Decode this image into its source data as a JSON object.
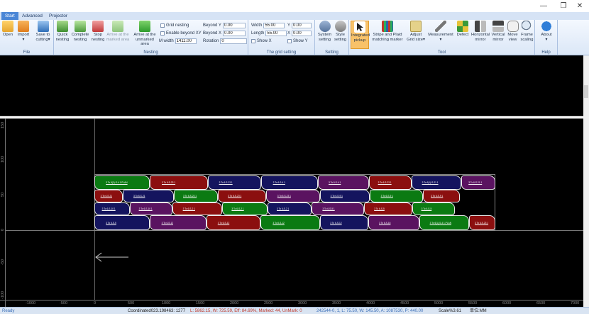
{
  "window": {
    "min_glyph": "—",
    "max_glyph": "❐",
    "close_glyph": "✕"
  },
  "tabs": [
    {
      "label": "Start",
      "active": true
    },
    {
      "label": "Advanced",
      "active": false
    },
    {
      "label": "Projector",
      "active": false
    }
  ],
  "ribbon": {
    "file": {
      "group_label": "File",
      "open": "Open",
      "import": "Import",
      "import_arrow": "▾",
      "save_to_cutting": "Save to cutting▾"
    },
    "nesting": {
      "group_label": "Nesting",
      "quick": "Quick nesting",
      "complete": "Complete nesting",
      "stop": "Stop nesting",
      "arrive_marked": "Arrive at the marked area",
      "arrive_unmarked": "Arrive at the unmarked area",
      "grid_nesting": "Grid nesting",
      "enable_beyond_xy": "Enable beyond XY",
      "m_width_label": "M width",
      "m_width_value": "1411.00",
      "beyond_y_label": "Beyond Y",
      "beyond_y_value": "0.00",
      "beyond_x_label": "Beyond X",
      "beyond_x_value": "0.00",
      "rotation_label": "Rotation",
      "rotation_value": "0"
    },
    "grid_setting": {
      "group_label": "The grid setting",
      "width_label": "Width",
      "width_value": "55.00",
      "length_label": "Length",
      "length_value": "55.00",
      "y_label": "Y",
      "y_value": "0.00",
      "x_label": "X",
      "x_value": "0.00",
      "show_x": "Show X",
      "show_y": "Show Y"
    },
    "setting": {
      "group_label": "Setting",
      "system": "System setting",
      "style": "Style setting"
    },
    "tool": {
      "group_label": "Tool",
      "integrated_pickup": "Integrated pickup",
      "stripe_plaid": "Stripe and Plaid matching marker",
      "adjust_grid": "Adjust Grid size▾",
      "measurement": "Measurement",
      "measurement_arrow": "▾",
      "defect": "Defect",
      "hmirror": "Horizontal mirror",
      "vmirror": "Vertical mirror",
      "move_view": "Move view",
      "frame_scaling": "Frame scaling"
    },
    "help": {
      "group_label": "Help",
      "about": "About",
      "about_arrow": "▾"
    }
  },
  "rulers": {
    "left": [
      "150",
      "100",
      "50",
      "0",
      "-50",
      "-100"
    ],
    "bottom": [
      "-1000",
      "-500",
      "0",
      "500",
      "1000",
      "1500",
      "2000",
      "2500",
      "3000",
      "3500",
      "4000",
      "4500",
      "5000",
      "5500",
      "6000",
      "6500",
      "7000"
    ]
  },
  "pieces": [
    {
      "c": "#0b7a12",
      "label": "3 To 6(1)-S-4 1.PLAN"
    },
    {
      "c": "#8b0f0f",
      "label": "3 To 6-S-23 1"
    },
    {
      "c": "#14145e",
      "label": "3 To 6-S-23 1"
    },
    {
      "c": "#14145e",
      "label": "3 To 6-S-4 1"
    },
    {
      "c": "#5a1360",
      "label": "3 To 6-S-4 1"
    },
    {
      "c": "#8b0f0f",
      "label": "3 To 6-S-23 1"
    },
    {
      "c": "#14145e",
      "label": "3 To 6(1)-S-21 1"
    },
    {
      "c": "#5a1360",
      "label": "3 To 6-S-21 1"
    },
    {
      "c": "#8b0f0f",
      "label": "3 To 6-S-21"
    },
    {
      "c": "#14145e",
      "label": "3 To 6-S-21"
    },
    {
      "c": "#0b7a12",
      "label": "3 To 6-S-23 1"
    },
    {
      "c": "#8b0f0f",
      "label": "3 To 6-S-23 1"
    },
    {
      "c": "#5a1360",
      "label": "3 To 6-S-23 1"
    },
    {
      "c": "#14145e",
      "label": "3 To 6-S-9 1"
    },
    {
      "c": "#0b7a12",
      "label": "3 To 6-S-9 1"
    },
    {
      "c": "#8b0f0f",
      "label": "3 To 6-S-9 1"
    },
    {
      "c": "#14145e",
      "label": "3 To 6-S-10 1"
    },
    {
      "c": "#5a1360",
      "label": "3 To 6-S-10 1"
    },
    {
      "c": "#8b0f0f",
      "label": "3 To 6-S-2 1"
    },
    {
      "c": "#0b7a12",
      "label": "3 To 6-S-2 1"
    },
    {
      "c": "#14145e",
      "label": "3 To 6-S-2 1"
    },
    {
      "c": "#5a1360",
      "label": "3 To 6-S-5 1"
    },
    {
      "c": "#8b0f0f",
      "label": "3 To 6-S-5"
    },
    {
      "c": "#0b7a12",
      "label": "3 To 6-S-5"
    },
    {
      "c": "#14145e",
      "label": "3 To 6-S-5"
    },
    {
      "c": "#5a1360",
      "label": "3 To 6-S-12"
    },
    {
      "c": "#8b0f0f",
      "label": "3 To 6-S-12"
    },
    {
      "c": "#0b7a12",
      "label": "3 To 6-S-12"
    },
    {
      "c": "#14145e",
      "label": "3 To 6-S-12"
    },
    {
      "c": "#5a1360",
      "label": "3 To 6-S-16"
    }
  ],
  "status": {
    "ready": "Ready",
    "coords": "Coordinated023.198463: 1277",
    "summary": "L: 5862.15,  W: 725.59,  Eff: 84.69%,  Marked: 44,  UnMark: 0",
    "selection": "242544-0, 1,  L: 75.50,  W: 145.50,  A: 1087530,  P: 440.00",
    "scale": "Scale%3.61",
    "unit": "单位:MM"
  },
  "colors": {
    "green": "#0b7a12",
    "red": "#8b0f0f",
    "navy": "#14145e",
    "purple": "#5a1360",
    "status_red": "#c0392b",
    "status_blue": "#3b6fb8"
  }
}
